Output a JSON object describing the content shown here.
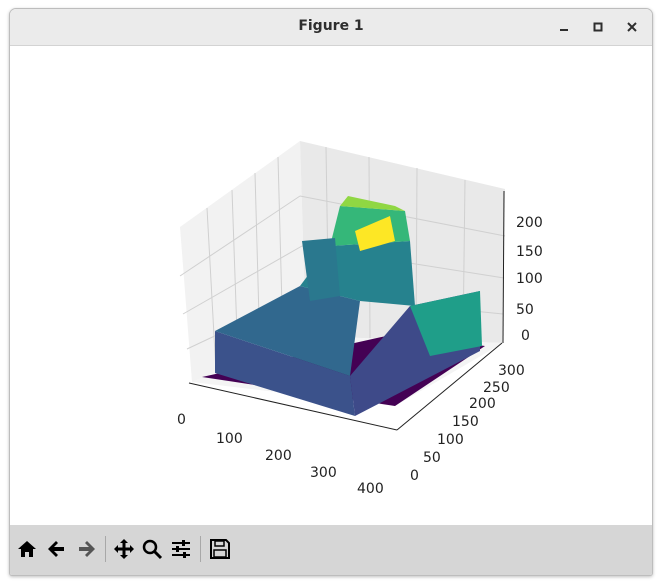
{
  "window": {
    "title": "Figure 1"
  },
  "controls": [
    "minimize-icon",
    "maximize-icon",
    "close-icon"
  ],
  "toolbar": [
    "home-icon",
    "back-icon",
    "forward-icon",
    "pan-icon",
    "zoom-icon",
    "configure-subplots-icon",
    "save-icon"
  ],
  "chart_data": {
    "type": "surface",
    "colormap": "viridis",
    "title": "",
    "x_ticks": [
      "0",
      "100",
      "200",
      "300",
      "400"
    ],
    "y_ticks": [
      "0",
      "50",
      "100",
      "150",
      "200",
      "250",
      "300"
    ],
    "z_ticks": [
      "0",
      "50",
      "100",
      "150",
      "200"
    ],
    "xlim": [
      0,
      400
    ],
    "ylim": [
      0,
      300
    ],
    "zlim": [
      0,
      240
    ],
    "grid": true
  }
}
